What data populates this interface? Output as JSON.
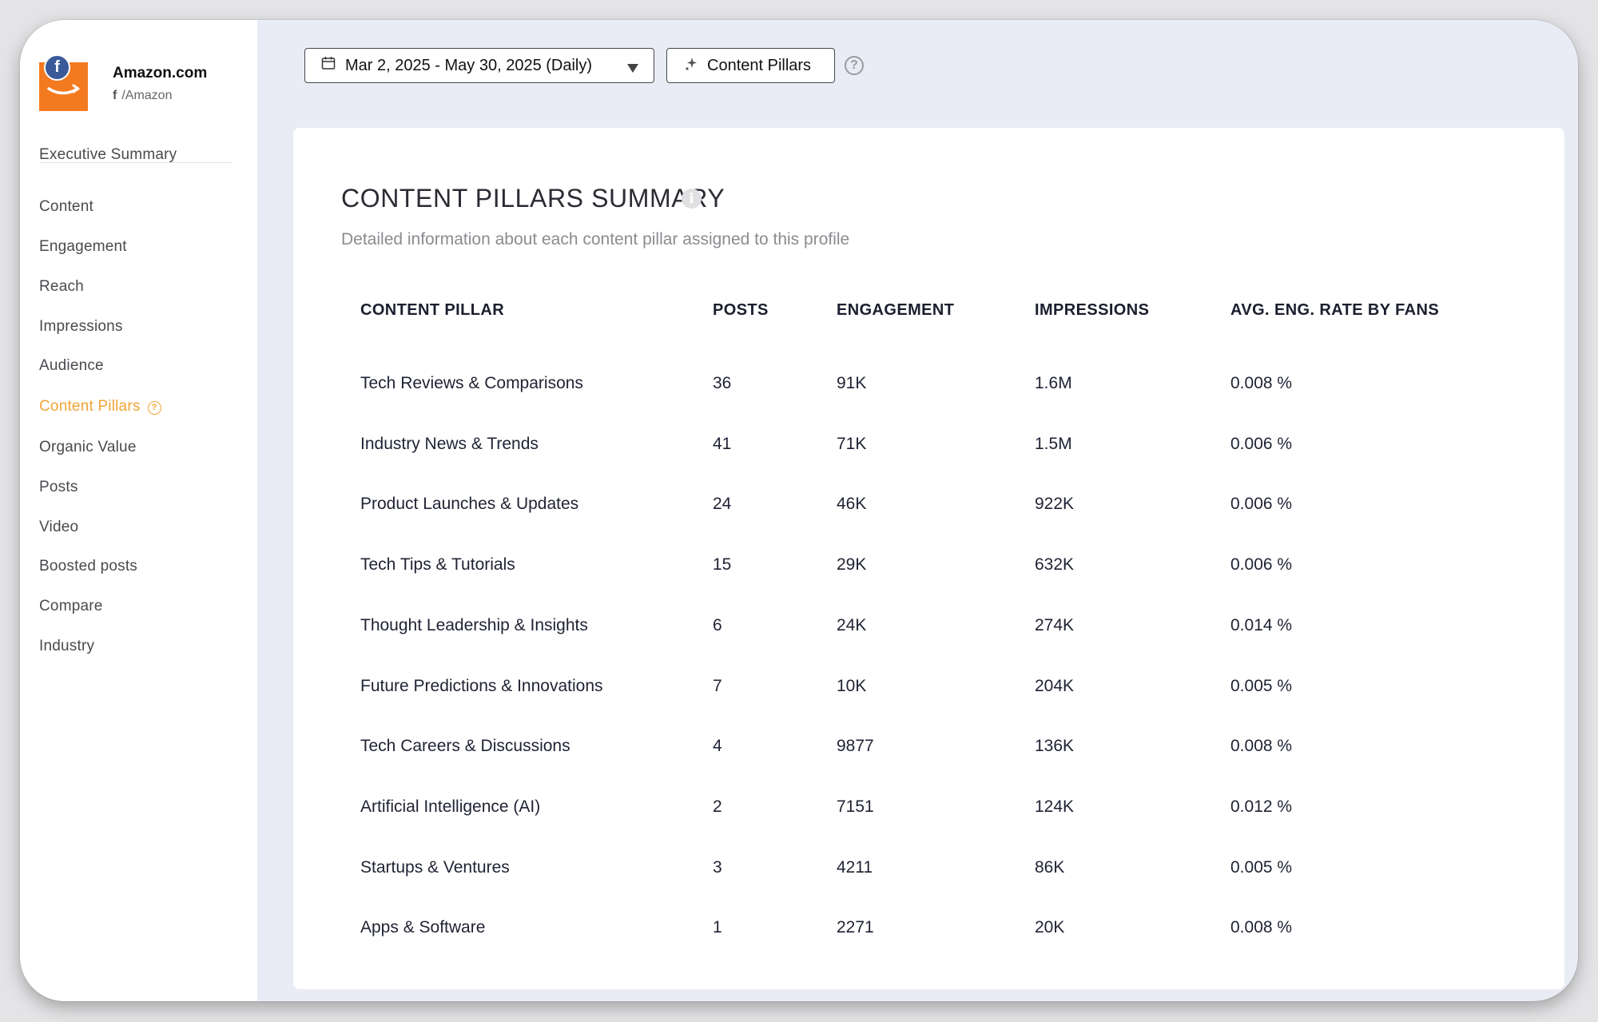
{
  "colors": {
    "accent": "#f0a535",
    "logo": "#f47a20",
    "facebook": "#3b5a9a"
  },
  "profile": {
    "name": "Amazon.com",
    "handle": "/Amazon",
    "network_icon": "facebook-icon",
    "badge_letter": "f"
  },
  "sidebar": {
    "items": [
      {
        "label": "Executive Summary"
      },
      {
        "label": "Content"
      },
      {
        "label": "Engagement"
      },
      {
        "label": "Reach"
      },
      {
        "label": "Impressions"
      },
      {
        "label": "Audience"
      },
      {
        "label": "Content Pillars",
        "active": true
      },
      {
        "label": "Organic Value"
      },
      {
        "label": "Posts"
      },
      {
        "label": "Video"
      },
      {
        "label": "Boosted posts"
      },
      {
        "label": "Compare"
      },
      {
        "label": "Industry"
      }
    ]
  },
  "toolbar": {
    "date_range": "Mar 2, 2025 - May 30, 2025 (Daily)",
    "pillars_button": "Content Pillars"
  },
  "summary": {
    "title": "CONTENT PILLARS SUMMARY",
    "subtitle": "Detailed information about each content pillar assigned to this profile",
    "columns": [
      "CONTENT PILLAR",
      "POSTS",
      "ENGAGEMENT",
      "IMPRESSIONS",
      "AVG. ENG. RATE BY FANS"
    ],
    "rows": [
      {
        "pillar": "Tech Reviews & Comparisons",
        "posts": "36",
        "engagement": "91K",
        "impressions": "1.6M",
        "rate": "0.008 %"
      },
      {
        "pillar": "Industry News & Trends",
        "posts": "41",
        "engagement": "71K",
        "impressions": "1.5M",
        "rate": "0.006 %"
      },
      {
        "pillar": "Product Launches & Updates",
        "posts": "24",
        "engagement": "46K",
        "impressions": "922K",
        "rate": "0.006 %"
      },
      {
        "pillar": "Tech Tips & Tutorials",
        "posts": "15",
        "engagement": "29K",
        "impressions": "632K",
        "rate": "0.006 %"
      },
      {
        "pillar": "Thought Leadership & Insights",
        "posts": "6",
        "engagement": "24K",
        "impressions": "274K",
        "rate": "0.014 %"
      },
      {
        "pillar": "Future Predictions & Innovations",
        "posts": "7",
        "engagement": "10K",
        "impressions": "204K",
        "rate": "0.005 %"
      },
      {
        "pillar": "Tech Careers & Discussions",
        "posts": "4",
        "engagement": "9877",
        "impressions": "136K",
        "rate": "0.008 %"
      },
      {
        "pillar": "Artificial Intelligence (AI)",
        "posts": "2",
        "engagement": "7151",
        "impressions": "124K",
        "rate": "0.012 %"
      },
      {
        "pillar": "Startups & Ventures",
        "posts": "3",
        "engagement": "4211",
        "impressions": "86K",
        "rate": "0.005 %"
      },
      {
        "pillar": "Apps & Software",
        "posts": "1",
        "engagement": "2271",
        "impressions": "20K",
        "rate": "0.008 %"
      }
    ]
  }
}
